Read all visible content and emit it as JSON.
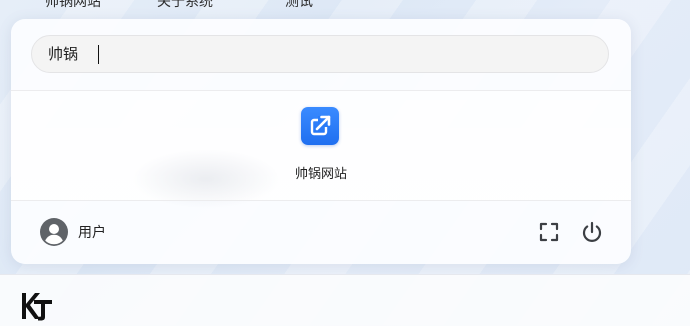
{
  "desktop": {
    "labels": [
      "帅锅网站",
      "关于系统",
      "测试"
    ]
  },
  "search": {
    "value": "帅锅",
    "placeholder": ""
  },
  "results": [
    {
      "label": "帅锅网站",
      "icon": "external-link-icon"
    }
  ],
  "footer": {
    "user_label": "用户"
  },
  "colors": {
    "app_icon_blue": "#1f6ff0",
    "icon_gray": "#5f6368"
  }
}
